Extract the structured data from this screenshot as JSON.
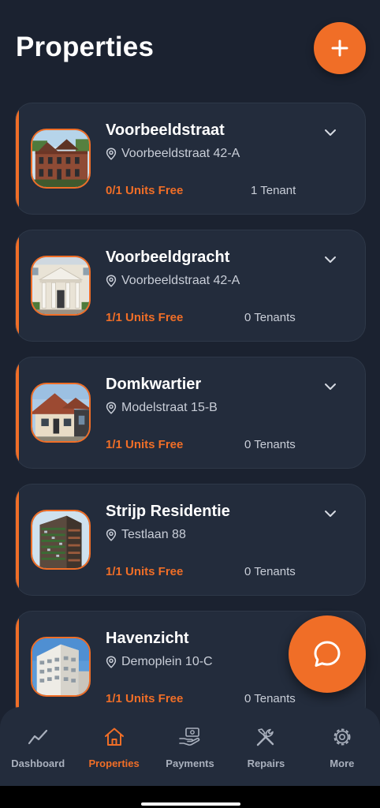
{
  "header": {
    "title": "Properties"
  },
  "properties": [
    {
      "name": "Voorbeeldstraat",
      "address": "Voorbeeldstraat 42-A",
      "units": "0/1 Units Free",
      "tenants": "1 Tenant"
    },
    {
      "name": "Voorbeeldgracht",
      "address": "Voorbeeldstraat 42-A",
      "units": "1/1 Units Free",
      "tenants": "0 Tenants"
    },
    {
      "name": "Domkwartier",
      "address": "Modelstraat 15-B",
      "units": "1/1 Units Free",
      "tenants": "0 Tenants"
    },
    {
      "name": "Strijp Residentie",
      "address": "Testlaan 88",
      "units": "1/1 Units Free",
      "tenants": "0 Tenants"
    },
    {
      "name": "Havenzicht",
      "address": "Demoplein 10-C",
      "units": "1/1 Units Free",
      "tenants": "0 Tenants"
    }
  ],
  "nav": {
    "items": [
      {
        "label": "Dashboard",
        "icon": "chart-line-icon"
      },
      {
        "label": "Properties",
        "icon": "home-icon",
        "active": true
      },
      {
        "label": "Payments",
        "icon": "payment-hand-icon"
      },
      {
        "label": "Repairs",
        "icon": "tools-icon"
      },
      {
        "label": "More",
        "icon": "gear-icon"
      }
    ]
  },
  "colors": {
    "accent": "#f06e27",
    "background": "#1b2230",
    "card": "#232c3c"
  }
}
